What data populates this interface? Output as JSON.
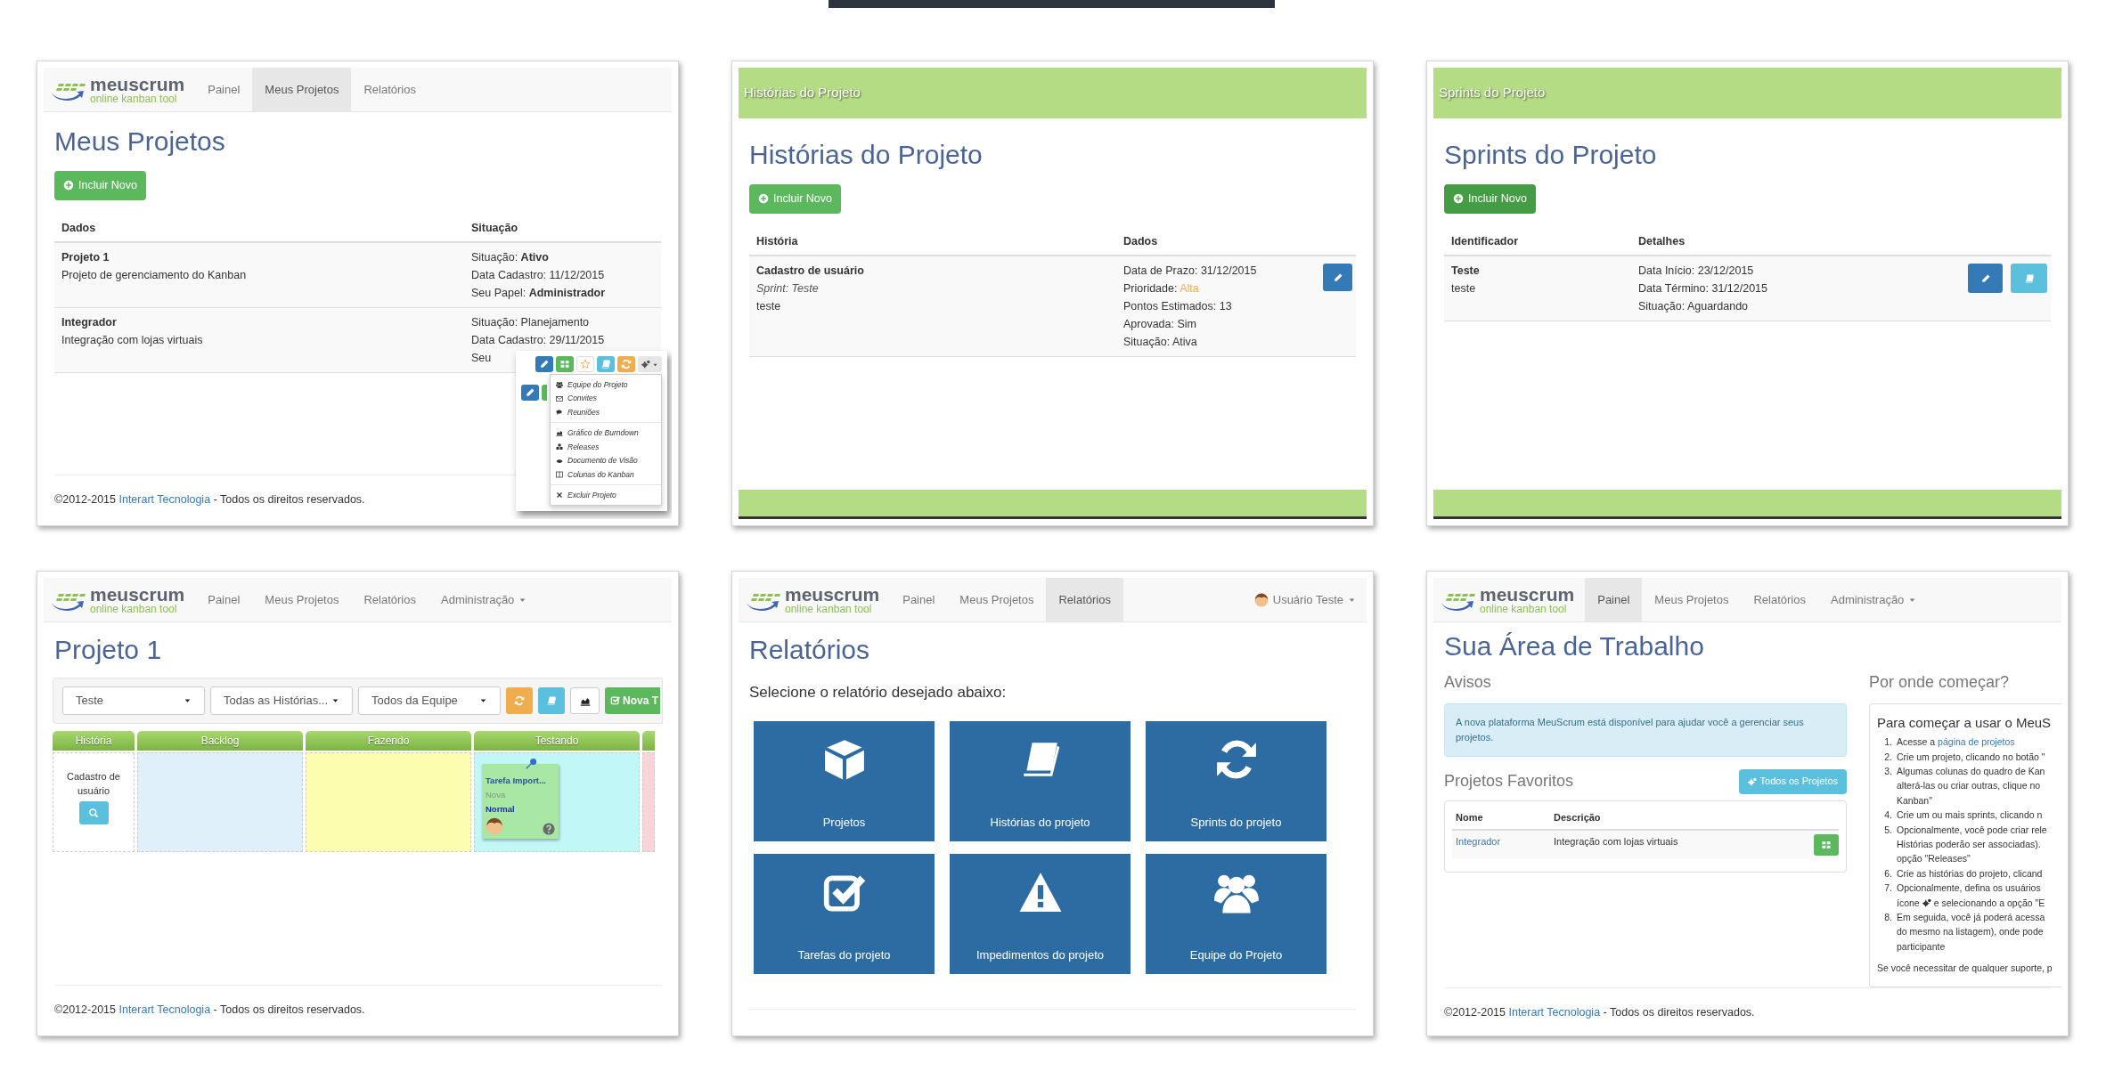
{
  "panels": [
    {
      "kind": "projects",
      "navbar": {
        "logo": {
          "name": "meuscrum",
          "tagline": "online kanban tool"
        },
        "items": [
          {
            "label": "Painel",
            "selected": false
          },
          {
            "label": "Meus Projetos",
            "selected": true
          },
          {
            "label": "Relatórios",
            "selected": false
          }
        ]
      },
      "title": "Meus Projetos",
      "add_button": "Incluir Novo",
      "table": {
        "columns": [
          "Dados",
          "Situação"
        ],
        "rows": [
          {
            "name": "Projeto 1",
            "description": "Projeto de gerenciamento do Kanban",
            "details": [
              {
                "label": "Situação:",
                "value": "Ativo",
                "bold": true
              },
              {
                "label": "Data Cadastro:",
                "value": "11/12/2015",
                "bold": false
              },
              {
                "label": "Seu Papel:",
                "value": "Administrador",
                "bold": true
              }
            ]
          },
          {
            "name": "Integrador",
            "description": "Integração com lojas virtuais",
            "details": [
              {
                "label": "Situação:",
                "value": "Planejamento",
                "bold": false
              },
              {
                "label": "Data Cadastro:",
                "value": "29/11/2015",
                "bold": false
              },
              {
                "label": "Seu"
              }
            ]
          }
        ]
      },
      "action_menu": {
        "groups": [
          [
            "Equipe do Projeto",
            "Convites",
            "Reuniões"
          ],
          [
            "Gráfico de Burndown",
            "Releases",
            "Documento de Visão",
            "Colunas do Kanban"
          ],
          [
            "Excluir Projeto"
          ]
        ]
      },
      "footer": {
        "before": "©2012-2015",
        "link": "Interart Tecnologia",
        "after": "- Todos os direitos reservados."
      }
    },
    {
      "kind": "stories",
      "header_bar": "Histórias do Projeto",
      "title": "Histórias do Projeto",
      "add_button": "Incluir Novo",
      "table": {
        "columns": [
          "História",
          "Dados"
        ],
        "rows": [
          {
            "name": "Cadastro de usuário",
            "sprint": "Sprint: Teste",
            "description": "teste",
            "details": [
              {
                "label": "Data de Prazo:",
                "value": "31/12/2015",
                "warning": false
              },
              {
                "label": "Prioridade:",
                "value": "Alta",
                "warning": true
              },
              {
                "label": "Pontos Estimados:",
                "value": "13",
                "warning": false
              },
              {
                "label": "Aprovada:",
                "value": "Sim",
                "warning": false
              },
              {
                "label": "Situação:",
                "value": "Ativa",
                "warning": false
              }
            ]
          }
        ]
      }
    },
    {
      "kind": "sprints",
      "header_bar": "Sprints do Projeto",
      "title": "Sprints do Projeto",
      "add_button": "Incluir Novo",
      "table": {
        "columns": [
          "Identificador",
          "Detalhes"
        ],
        "rows": [
          {
            "name": "Teste",
            "description": "teste",
            "details": [
              {
                "label": "Data Início:",
                "value": "23/12/2015"
              },
              {
                "label": "Data Término:",
                "value": "31/12/2015"
              },
              {
                "label": "Situação:",
                "value": "Aguardando"
              }
            ]
          }
        ]
      }
    },
    {
      "kind": "kanban",
      "navbar": {
        "logo": {
          "name": "meuscrum",
          "tagline": "online kanban tool"
        },
        "items": [
          {
            "label": "Painel",
            "selected": false
          },
          {
            "label": "Meus Projetos",
            "selected": false
          },
          {
            "label": "Relatórios",
            "selected": false
          },
          {
            "label": "Administração",
            "selected": false,
            "dropdown": true
          }
        ]
      },
      "title": "Projeto 1",
      "filters": [
        "Teste",
        "Todas as Histórias...",
        "Todos da Equipe"
      ],
      "new_task_button": "Nova T",
      "board": {
        "columns": [
          "História",
          "Backlog",
          "Fazendo",
          "Testando"
        ],
        "rows": [
          {
            "story": "Cadastro de usuário",
            "cells": [
              [],
              [],
              [
                {
                  "title": "Tarefa Import...",
                  "status": "Nova",
                  "priority": "Normal"
                }
              ]
            ]
          }
        ]
      },
      "footer": {
        "before": "©2012-2015",
        "link": "Interart Tecnologia",
        "after": "- Todos os direitos reservados."
      }
    },
    {
      "kind": "reports",
      "navbar": {
        "logo": {
          "name": "meuscrum",
          "tagline": "online kanban tool"
        },
        "items": [
          {
            "label": "Painel",
            "selected": false
          },
          {
            "label": "Meus Projetos",
            "selected": false
          },
          {
            "label": "Relatórios",
            "selected": true
          }
        ],
        "user": "Usuário Teste"
      },
      "title": "Relatórios",
      "subtitle": "Selecione o relatório desejado abaixo:",
      "tiles": [
        "Projetos",
        "Histórias do projeto",
        "Sprints do projeto",
        "Tarefas do projeto",
        "Impedimentos do projeto",
        "Equipe do Projeto"
      ]
    },
    {
      "kind": "dashboard",
      "navbar": {
        "logo": {
          "name": "meuscrum",
          "tagline": "online kanban tool"
        },
        "items": [
          {
            "label": "Painel",
            "selected": true
          },
          {
            "label": "Meus Projetos",
            "selected": false
          },
          {
            "label": "Relatórios",
            "selected": false
          },
          {
            "label": "Administração",
            "selected": false,
            "dropdown": true
          }
        ]
      },
      "title": "Sua Área de Trabalho",
      "notices": {
        "heading": "Avisos",
        "message": "A nova plataforma MeuScrum está disponível para ajudar você a gerenciar seus projetos."
      },
      "favorites": {
        "heading": "Projetos Favoritos",
        "button": "Todos os Projetos",
        "columns": [
          "Nome",
          "Descrição"
        ],
        "rows": [
          {
            "name": "Integrador",
            "description": "Integração com lojas virtuais"
          }
        ]
      },
      "getting_started": {
        "heading": "Por onde começar?",
        "panel_title": "Para começar a usar o MeuS",
        "steps": [
          {
            "number": "1.",
            "lines": [
              {
                "text": "Acesse a",
                "link": "página de projetos"
              }
            ]
          },
          {
            "number": "2.",
            "lines": [
              "Crie um projeto, clicando no botão \""
            ]
          },
          {
            "number": "3.",
            "lines": [
              "Algumas colunas do quadro de Kan",
              "alterá-las ou criar outras, clique no",
              "Kanban\""
            ]
          },
          {
            "number": "4.",
            "lines": [
              "Crie um ou mais sprints, clicando n"
            ]
          },
          {
            "number": "5.",
            "lines": [
              "Opcionalmente, você pode criar rele",
              "Histórias poderão ser associadas).",
              "opção \"Releases\""
            ]
          },
          {
            "number": "6.",
            "lines": [
              "Crie as histórias do projeto, clicand"
            ]
          },
          {
            "number": "7.",
            "lines": [
              "Opcionalmente, defina os usuários",
              {
                "before": "ícone",
                "after": "e selecionando a opção \"E"
              }
            ]
          },
          {
            "number": "8.",
            "lines": [
              "Em seguida, você já poderá acessa",
              "do mesmo na listagem), onde pode",
              "participante"
            ]
          }
        ],
        "note": "Se você necessitar de qualquer suporte, p"
      },
      "footer": {
        "before": "©2012-2015",
        "link": "Interart Tecnologia",
        "after": "- Todos os direitos reservados."
      }
    }
  ]
}
